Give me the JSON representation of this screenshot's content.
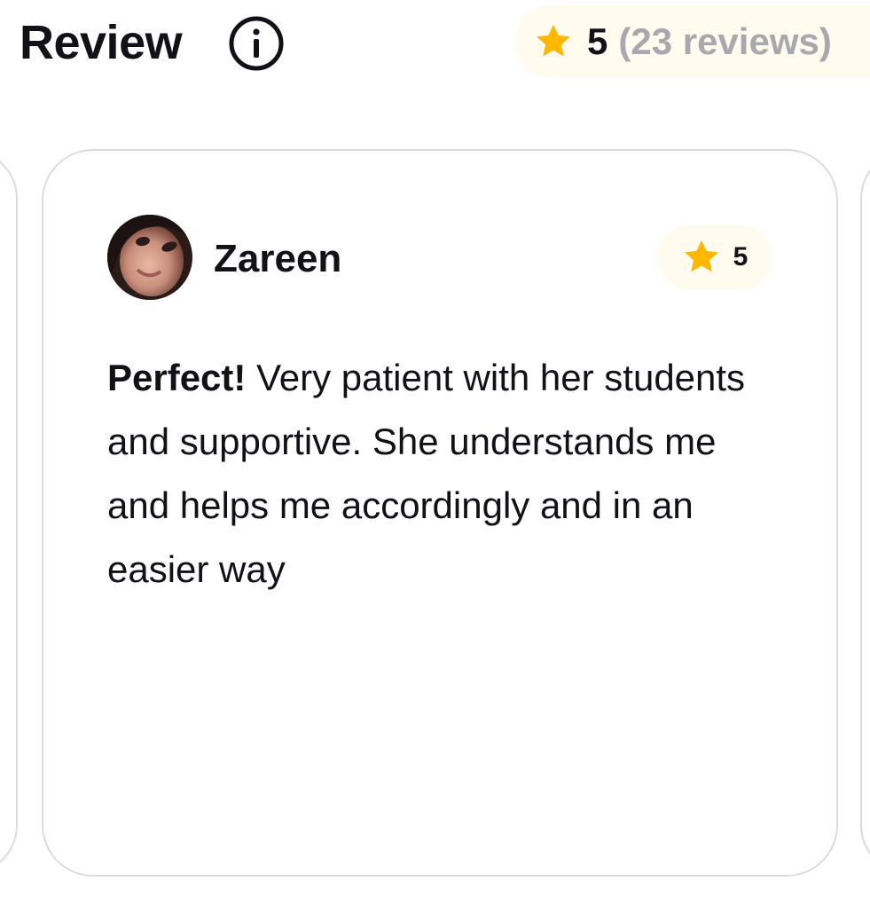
{
  "header": {
    "title": "Review",
    "info_icon": "info-circle-icon"
  },
  "summary": {
    "rating": "5",
    "reviews_count": "(23 reviews)",
    "star_icon": "star-icon",
    "star_color": "#ffb700",
    "badge_background": "#fffbef",
    "count_color": "#a8a8ad"
  },
  "review": {
    "reviewer_name": "Zareen",
    "rating": "5",
    "headline": "Perfect!",
    "text": " Very patient with her students and supportive. She understands me and helps me accordingly and in an easier way"
  },
  "colors": {
    "text": "#121117",
    "card_border": "#dcdcde"
  }
}
